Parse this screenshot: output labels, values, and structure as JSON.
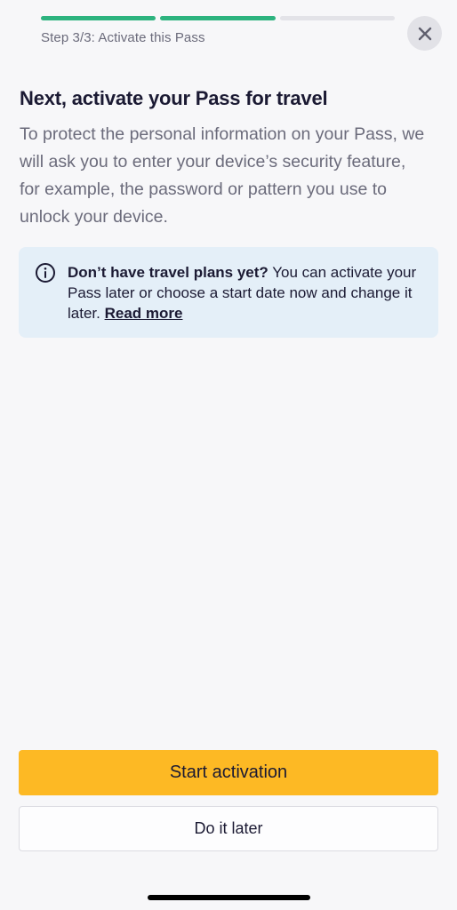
{
  "progress": {
    "total_steps": 3,
    "completed_steps": 2,
    "label": "Step 3/3: Activate this Pass",
    "done_color": "#2db37f",
    "pending_color": "#e3e3e8"
  },
  "header": {
    "close_icon": "close-icon"
  },
  "main": {
    "title": "Next, activate your Pass for travel",
    "description": "To protect the personal information on your Pass, we will ask you to enter your device’s security feature, for example, the password or pattern you use to unlock your device."
  },
  "info": {
    "icon": "info-icon",
    "bold": "Don’t have travel plans yet?",
    "text": " You can activate your Pass later or choose a start date now and change it later. ",
    "link": "Read more"
  },
  "actions": {
    "primary_label": "Start activation",
    "primary_color": "#fdb924",
    "secondary_label": "Do it later"
  }
}
